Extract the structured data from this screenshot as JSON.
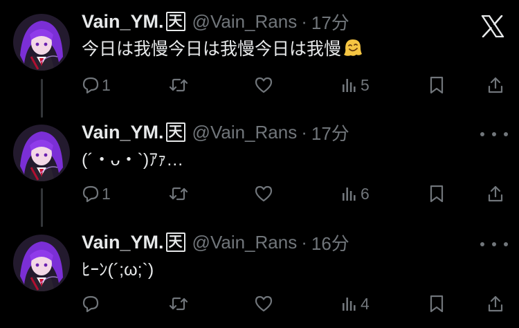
{
  "app": {
    "logo": "x-logo-icon"
  },
  "tweets": [
    {
      "display_name": "Vain_YM.",
      "badge": "天",
      "handle": "@Vain_Rans",
      "separator": "·",
      "time": "17分",
      "text": "今日は我慢今日は我慢今日は我慢",
      "emoji": "melting-face-emoji",
      "replies": "1",
      "retweets": "",
      "likes": "",
      "views": "5",
      "corner": "x-logo"
    },
    {
      "display_name": "Vain_YM.",
      "badge": "天",
      "handle": "@Vain_Rans",
      "separator": "·",
      "time": "17分",
      "text": "(´・ᴗ・`)ｱｧ…",
      "replies": "1",
      "retweets": "",
      "likes": "",
      "views": "6",
      "corner": "more"
    },
    {
      "display_name": "Vain_YM.",
      "badge": "天",
      "handle": "@Vain_Rans",
      "separator": "·",
      "time": "16分",
      "text": "ﾋｰﾝ(´;ω;`)",
      "replies": "",
      "retweets": "",
      "likes": "",
      "views": "4",
      "corner": "more"
    }
  ],
  "colors": {
    "background": "#000000",
    "text": "#e7e9ea",
    "secondary": "#71767b",
    "thread_line": "#333639",
    "avatar_purple": "#8a2be2"
  }
}
